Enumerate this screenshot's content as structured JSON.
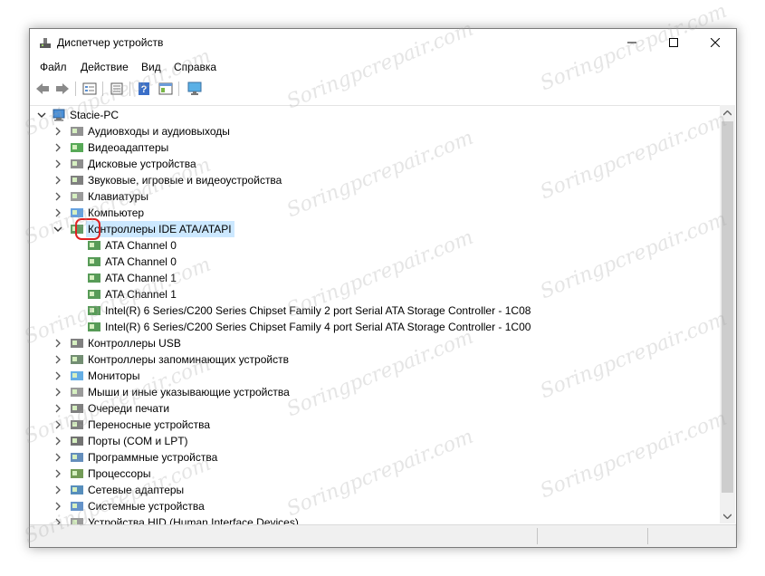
{
  "window": {
    "title": "Диспетчер устройств"
  },
  "menu": [
    {
      "label": "Файл"
    },
    {
      "label": "Действие"
    },
    {
      "label": "Вид"
    },
    {
      "label": "Справка"
    }
  ],
  "toolbar": {
    "buttons": [
      "back-icon",
      "forward-icon",
      "properties-icon",
      "list-icon",
      "help-icon",
      "update-driver-icon",
      "monitor-scan-icon"
    ]
  },
  "tree": {
    "root": "Stacie-PC",
    "items": [
      {
        "label": "Аудиовходы и аудиовыходы",
        "icon": "speaker-icon",
        "expanded": false
      },
      {
        "label": "Видеоадаптеры",
        "icon": "display-adapter-icon",
        "expanded": false
      },
      {
        "label": "Дисковые устройства",
        "icon": "disk-drive-icon",
        "expanded": false
      },
      {
        "label": "Звуковые, игровые и видеоустройства",
        "icon": "sound-icon",
        "expanded": false
      },
      {
        "label": "Клавиатуры",
        "icon": "keyboard-icon",
        "expanded": false
      },
      {
        "label": "Компьютер",
        "icon": "computer-icon",
        "expanded": false
      },
      {
        "label": "Контроллеры IDE ATA/ATAPI",
        "icon": "ide-controller-icon",
        "expanded": true,
        "selected": true,
        "children": [
          "ATA Channel 0",
          "ATA Channel 0",
          "ATA Channel 1",
          "ATA Channel 1",
          "Intel(R) 6 Series/C200 Series Chipset Family 2 port Serial ATA Storage Controller - 1C08",
          "Intel(R) 6 Series/C200 Series Chipset Family 4 port Serial ATA Storage Controller - 1C00"
        ]
      },
      {
        "label": "Контроллеры USB",
        "icon": "usb-icon",
        "expanded": false
      },
      {
        "label": "Контроллеры запоминающих устройств",
        "icon": "storage-controller-icon",
        "expanded": false
      },
      {
        "label": "Мониторы",
        "icon": "monitor-icon",
        "expanded": false
      },
      {
        "label": "Мыши и иные указывающие устройства",
        "icon": "mouse-icon",
        "expanded": false
      },
      {
        "label": "Очереди печати",
        "icon": "printer-icon",
        "expanded": false
      },
      {
        "label": "Переносные устройства",
        "icon": "portable-device-icon",
        "expanded": false
      },
      {
        "label": "Порты (COM и LPT)",
        "icon": "port-icon",
        "expanded": false
      },
      {
        "label": "Программные устройства",
        "icon": "software-device-icon",
        "expanded": false
      },
      {
        "label": "Процессоры",
        "icon": "processor-icon",
        "expanded": false
      },
      {
        "label": "Сетевые адаптеры",
        "icon": "network-adapter-icon",
        "expanded": false
      },
      {
        "label": "Системные устройства",
        "icon": "system-device-icon",
        "expanded": false
      },
      {
        "label": "Устройства HID (Human Interface Devices)",
        "icon": "hid-icon",
        "expanded": false
      }
    ]
  },
  "watermark_text": "Soringpcrepair.com",
  "colors": {
    "selection": "#cce8ff",
    "highlight_ring": "#e02020"
  }
}
